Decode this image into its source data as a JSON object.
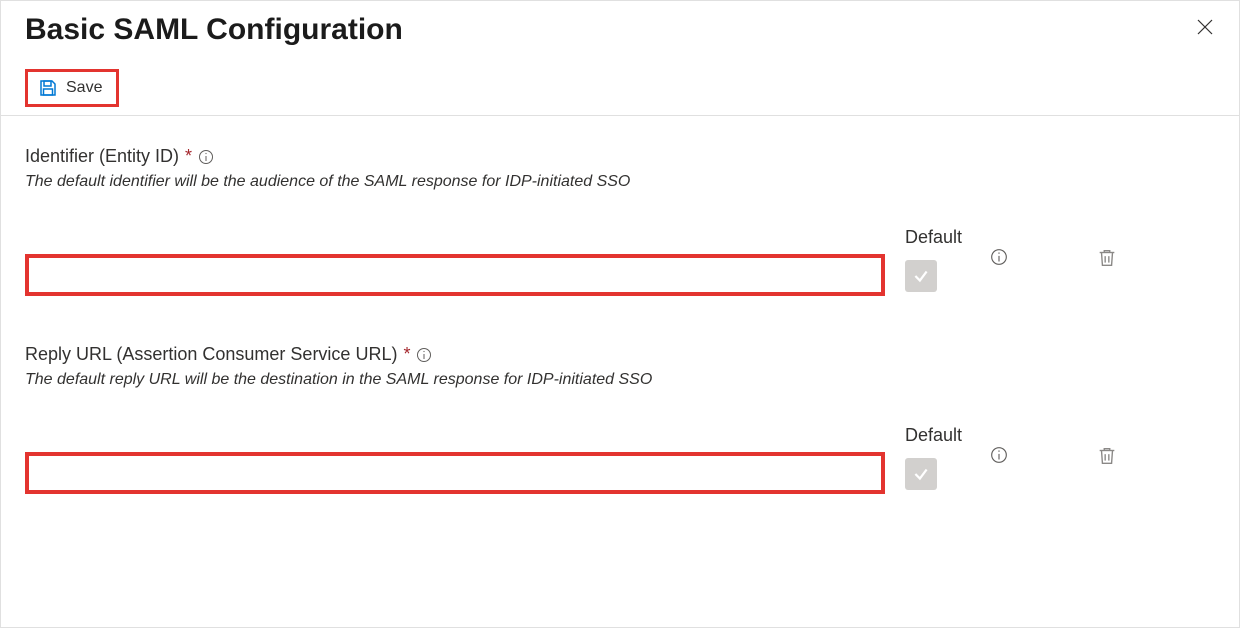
{
  "header": {
    "title": "Basic SAML Configuration"
  },
  "toolbar": {
    "save_label": "Save"
  },
  "sections": {
    "identifier": {
      "label": "Identifier (Entity ID)",
      "required_mark": "*",
      "description": "The default identifier will be the audience of the SAML response for IDP-initiated SSO",
      "default_header": "Default",
      "input_value": ""
    },
    "reply_url": {
      "label": "Reply URL (Assertion Consumer Service URL)",
      "required_mark": "*",
      "description": "The default reply URL will be the destination in the SAML response for IDP-initiated SSO",
      "default_header": "Default",
      "input_value": ""
    }
  }
}
